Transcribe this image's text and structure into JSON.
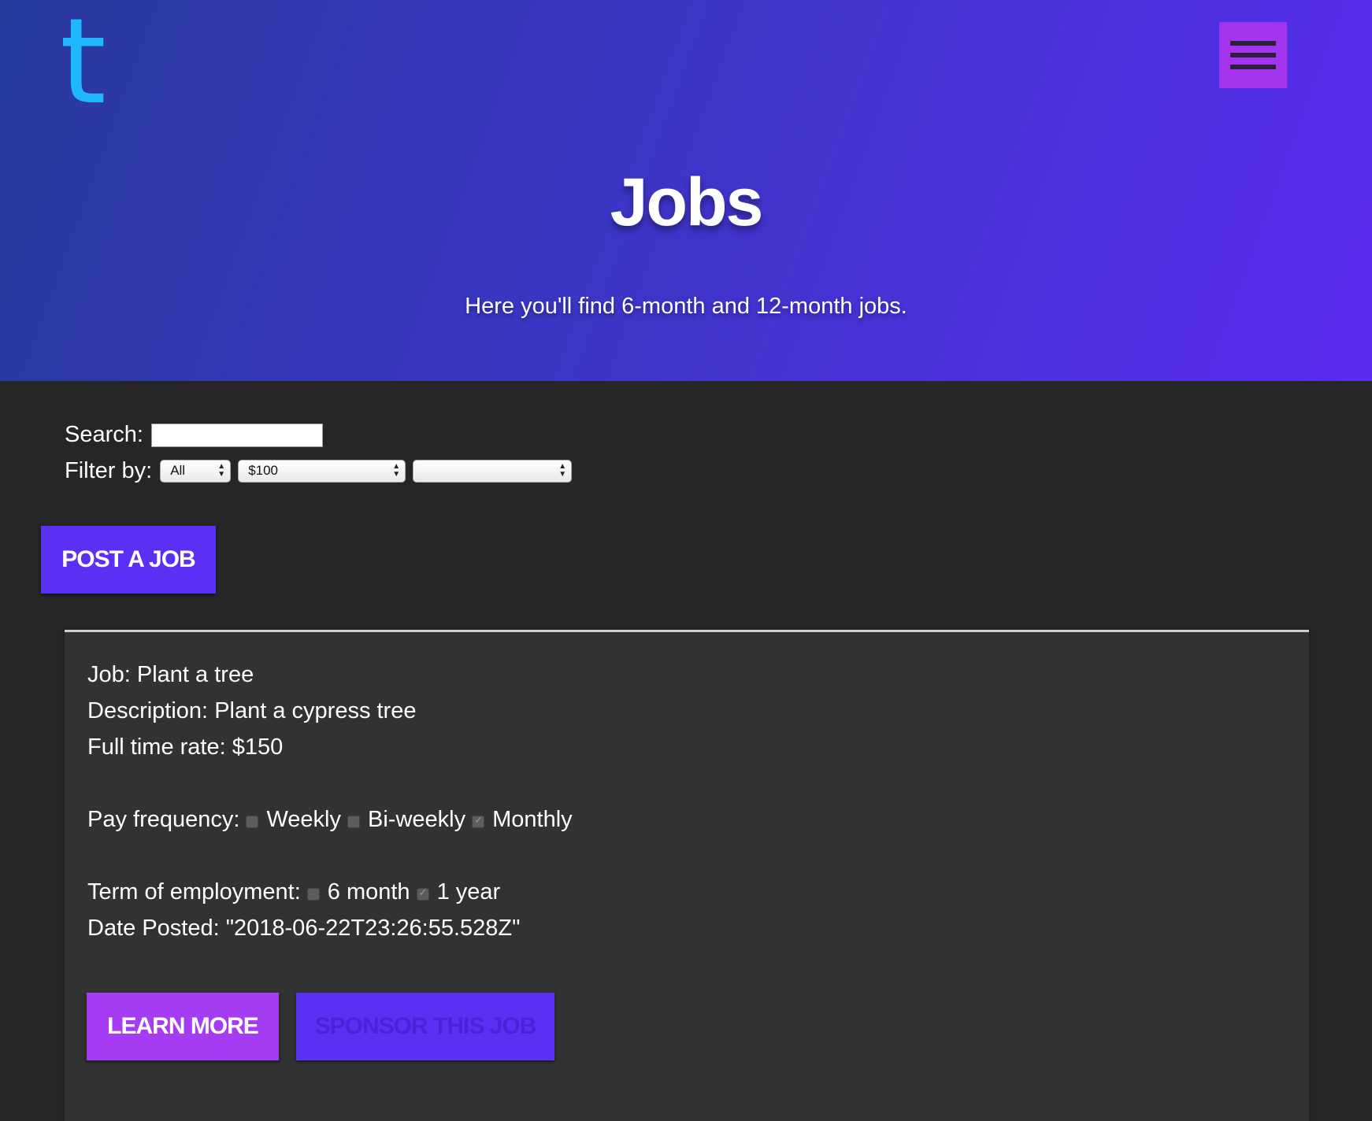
{
  "header": {
    "logo_text": "t",
    "menu_icon": "hamburger-menu-icon",
    "title": "Jobs",
    "subtitle": "Here you'll find 6-month and 12-month jobs.",
    "colors": {
      "gradient_start": "#283a9c",
      "gradient_end": "#5a2cf0",
      "logo": "#1fb8ff",
      "menu_button": "#a234ee"
    }
  },
  "filters": {
    "search_label": "Search:",
    "search_value": "",
    "filter_label": "Filter by:",
    "selects": [
      {
        "selected": "All"
      },
      {
        "selected": "$100"
      },
      {
        "selected": ""
      }
    ]
  },
  "actions": {
    "post_job_label": "POST A JOB",
    "post_job_color": "#5b30f5"
  },
  "job": {
    "title_label": "Job:",
    "title": "Plant a tree",
    "description_label": "Description:",
    "description": "Plant a cypress tree",
    "rate_label": "Full time rate:",
    "rate": "$150",
    "pay_frequency_label": "Pay frequency:",
    "pay_frequency_options": [
      {
        "label": "Weekly",
        "checked": false
      },
      {
        "label": "Bi-weekly",
        "checked": false
      },
      {
        "label": "Monthly",
        "checked": true
      }
    ],
    "term_label": "Term of employment:",
    "term_options": [
      {
        "label": "6 month",
        "checked": false
      },
      {
        "label": "1 year",
        "checked": true
      }
    ],
    "date_label": "Date Posted:",
    "date_posted": "\"2018-06-22T23:26:55.528Z\"",
    "learn_more_label": "LEARN MORE",
    "learn_more_color": "#a63cf2",
    "sponsor_label": "SPONSOR THIS JOB",
    "sponsor_color": "#5b30f5"
  }
}
